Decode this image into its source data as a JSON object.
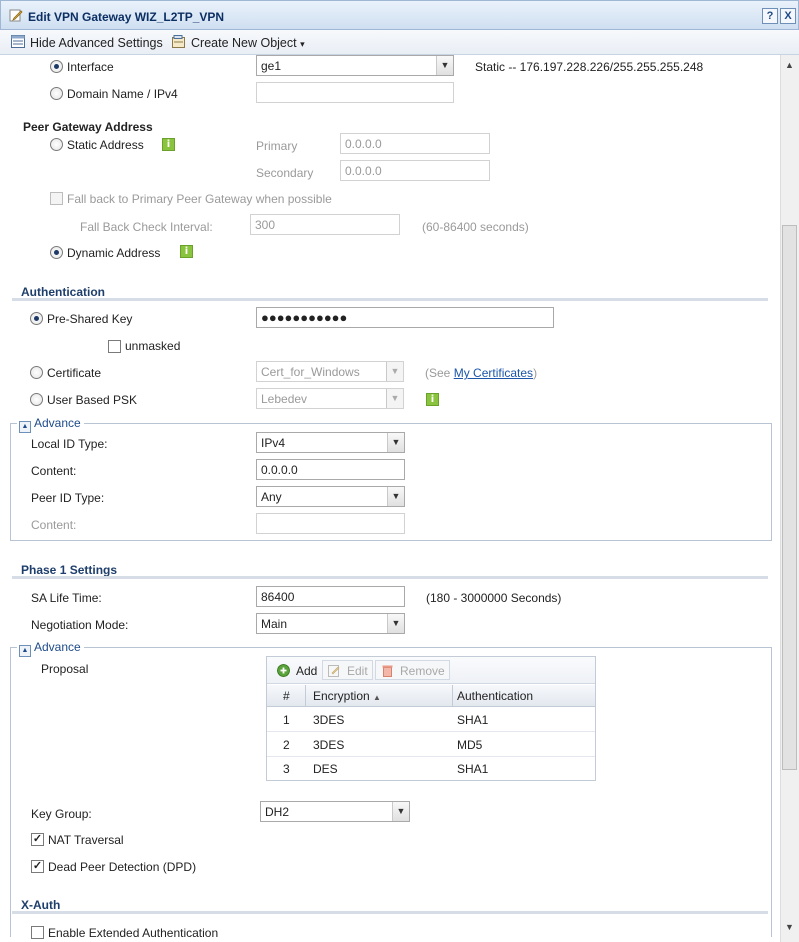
{
  "window": {
    "title": "Edit VPN Gateway WIZ_L2TP_VPN",
    "help_label": "?",
    "close_label": "X"
  },
  "toolbar": {
    "hide_advanced": "Hide Advanced Settings",
    "create_new_object": "Create New Object",
    "create_arrow": "▾"
  },
  "my_address": {
    "interface_label": "Interface",
    "interface_value": "ge1",
    "interface_info": "Static -- 176.197.228.226/255.255.255.248",
    "domain_label": "Domain Name / IPv4",
    "domain_value": ""
  },
  "peer_gateway": {
    "title": "Peer Gateway Address",
    "static_label": "Static Address",
    "primary_label": "Primary",
    "primary_value": "0.0.0.0",
    "secondary_label": "Secondary",
    "secondary_value": "0.0.0.0",
    "fallback_label": "Fall back to Primary Peer Gateway when possible",
    "fallback_interval_label": "Fall Back Check Interval:",
    "fallback_interval_value": "300",
    "fallback_interval_hint": "(60-86400 seconds)",
    "dynamic_label": "Dynamic Address"
  },
  "authentication": {
    "title": "Authentication",
    "psk_label": "Pre-Shared Key",
    "psk_value": "●●●●●●●●●●●",
    "unmasked_label": "unmasked",
    "certificate_label": "Certificate",
    "certificate_value": "Cert_for_Windows",
    "see_prefix": "(See",
    "my_certificates_link": "My Certificates",
    "see_suffix": ")",
    "user_psk_label": "User Based PSK",
    "user_psk_value": "Lebedev"
  },
  "advance1": {
    "legend": "Advance",
    "local_id_type_label": "Local ID Type:",
    "local_id_type_value": "IPv4",
    "content_label": "Content:",
    "content_value": "0.0.0.0",
    "peer_id_type_label": "Peer ID Type:",
    "peer_id_type_value": "Any",
    "peer_content_label": "Content:",
    "peer_content_value": ""
  },
  "phase1": {
    "title": "Phase 1 Settings",
    "sa_life_label": "SA Life Time:",
    "sa_life_value": "86400",
    "sa_life_hint": "(180 - 3000000 Seconds)",
    "negotiation_label": "Negotiation Mode:",
    "negotiation_value": "Main"
  },
  "advance2": {
    "legend": "Advance",
    "proposal_label": "Proposal",
    "add_label": "Add",
    "edit_label": "Edit",
    "remove_label": "Remove",
    "columns": {
      "num": "#",
      "encryption": "Encryption",
      "sort_glyph": "▲",
      "authentication": "Authentication"
    },
    "rows": [
      {
        "num": "1",
        "encryption": "3DES",
        "authentication": "SHA1"
      },
      {
        "num": "2",
        "encryption": "3DES",
        "authentication": "MD5"
      },
      {
        "num": "3",
        "encryption": "DES",
        "authentication": "SHA1"
      }
    ],
    "key_group_label": "Key Group:",
    "key_group_value": "DH2",
    "nat_label": "NAT Traversal",
    "dpd_label": "Dead Peer Detection (DPD)"
  },
  "xauth": {
    "title": "X-Auth",
    "enable_label": "Enable Extended Authentication"
  },
  "glyphs": {
    "dropdown": "▼",
    "scroll_up": "▲",
    "scroll_down": "▼",
    "collapse": "▲",
    "check": "✓",
    "info": "i"
  },
  "colors": {
    "section_title": "#1e3e6b",
    "info_icon": "#8ac43f",
    "link": "#1b56a8",
    "title_bar": "#cfdff1"
  }
}
